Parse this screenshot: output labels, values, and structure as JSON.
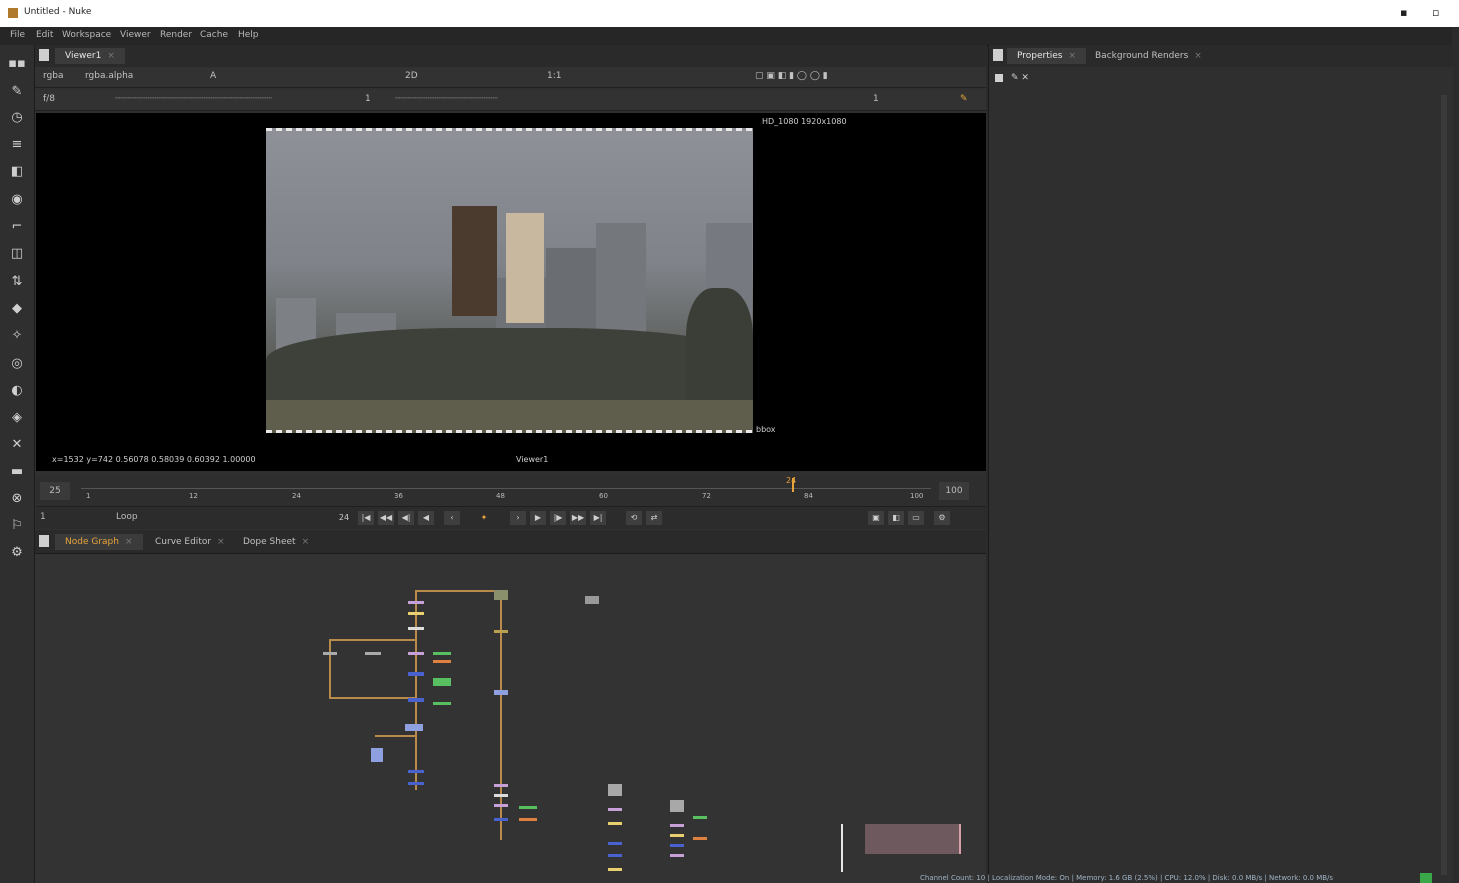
{
  "window": {
    "title": "Untitled - Nuke"
  },
  "menubar": {
    "items": [
      "File",
      "Edit",
      "Workspace",
      "Viewer",
      "Render",
      "Cache",
      "Help"
    ]
  },
  "toolbar": {
    "tools": [
      "image-icon",
      "draw-icon",
      "time-icon",
      "channel-icon",
      "color-icon",
      "filter-icon",
      "keyer-icon",
      "merge-icon",
      "transform-icon",
      "3d-icon",
      "particles-icon",
      "deep-icon",
      "views-icon",
      "metadata-icon",
      "toolsets-icon",
      "other-icon",
      "furnace-icon",
      "cara-icon",
      "bolt-icon",
      "gear-icon"
    ]
  },
  "viewer": {
    "tab_label": "Viewer1",
    "controls": {
      "channels": "rgba",
      "layer": "rgba.alpha",
      "input": "A",
      "gain_label": "f/8",
      "gamma_label": "1",
      "frame_mode": "1",
      "proxy": "2D",
      "zoom": "1:1",
      "fps": "25",
      "frame_current": "24",
      "frame_end": "100",
      "playback_mode": "Loop",
      "frame_field": "24"
    },
    "overlay": {
      "format_label": "HD_1080 1920x1080",
      "bbox_label": "bbox",
      "status_text": "x=1532 y=742 0.56078 0.58039 0.60392 1.00000",
      "center_text": "Viewer1"
    },
    "timeline": {
      "ticks": [
        "1",
        "12",
        "24",
        "36",
        "48",
        "60",
        "72",
        "84",
        "100"
      ]
    }
  },
  "bottom_tabs": [
    {
      "label": "Node Graph",
      "active": true
    },
    {
      "label": "Curve Editor",
      "active": false
    },
    {
      "label": "Dope Sheet",
      "active": false
    }
  ],
  "properties": {
    "tabs": [
      {
        "label": "Properties",
        "active": true
      },
      {
        "label": "Background Renders",
        "active": false
      }
    ]
  },
  "statusbar": {
    "text": "Channel Count: 10 | Localization Mode: On | Memory: 1.6 GB (2.5%) | CPU: 12.0% | Disk: 0.0 MB/s | Network: 0.0 MB/s"
  },
  "colors": {
    "accent": "#e8a33a",
    "wire": "#b88a4c",
    "panel": "#303030",
    "graph": "#333333"
  }
}
